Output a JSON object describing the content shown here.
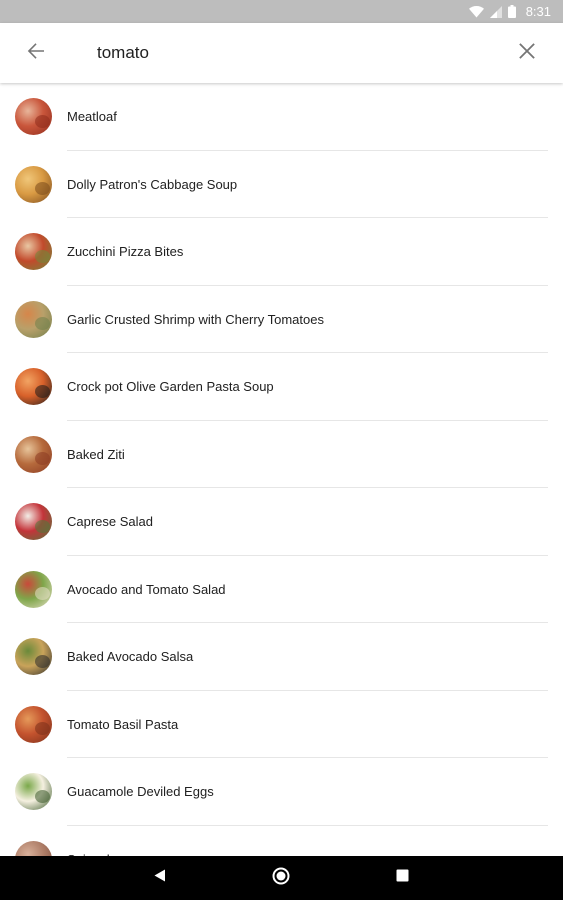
{
  "status_bar": {
    "time": "8:31",
    "icons": [
      "wifi-icon",
      "cell-signal-icon",
      "battery-icon"
    ]
  },
  "search": {
    "query": "tomato",
    "back_icon": "arrow-back-icon",
    "clear_icon": "close-icon"
  },
  "results": [
    {
      "label": "Meatloaf",
      "colors": [
        "#c9563b",
        "#e8b59a",
        "#8e2b1c"
      ]
    },
    {
      "label": "Dolly Patron's Cabbage Soup",
      "colors": [
        "#d99a43",
        "#f0c77a",
        "#7a4a1c"
      ]
    },
    {
      "label": "Zucchini Pizza Bites",
      "colors": [
        "#c24a2c",
        "#e9c7a3",
        "#6f8a3a"
      ]
    },
    {
      "label": "Garlic Crusted Shrimp with Cherry Tomatoes",
      "colors": [
        "#b9a06a",
        "#d6864a",
        "#6f7f4a"
      ]
    },
    {
      "label": "Crock pot Olive Garden Pasta Soup",
      "colors": [
        "#d8612a",
        "#f2a463",
        "#1a1a1a"
      ]
    },
    {
      "label": "Baked Ziti",
      "colors": [
        "#b66a3c",
        "#e7c49a",
        "#8a3a22"
      ]
    },
    {
      "label": "Caprese Salad",
      "colors": [
        "#c4343a",
        "#f3ede6",
        "#4f7a3a"
      ]
    },
    {
      "label": "Avocado and Tomato Salad",
      "colors": [
        "#7fa64a",
        "#c9493a",
        "#e8e0c8"
      ]
    },
    {
      "label": "Baked Avocado Salsa",
      "colors": [
        "#c9a35a",
        "#6a8a3a",
        "#2a2a2a"
      ]
    },
    {
      "label": "Tomato Basil Pasta",
      "colors": [
        "#c4532e",
        "#e59a5a",
        "#7a2f1a"
      ]
    },
    {
      "label": "Guacamole Deviled Eggs",
      "colors": [
        "#f5f0e0",
        "#7aa84a",
        "#3a5a2a"
      ]
    },
    {
      "label": "Spinach",
      "colors": [
        "#b0806a",
        "#d8b09a",
        "#7a4a3a"
      ]
    }
  ],
  "nav": {
    "back_icon": "nav-back-icon",
    "home_icon": "nav-home-icon",
    "recents_icon": "nav-recents-icon"
  }
}
